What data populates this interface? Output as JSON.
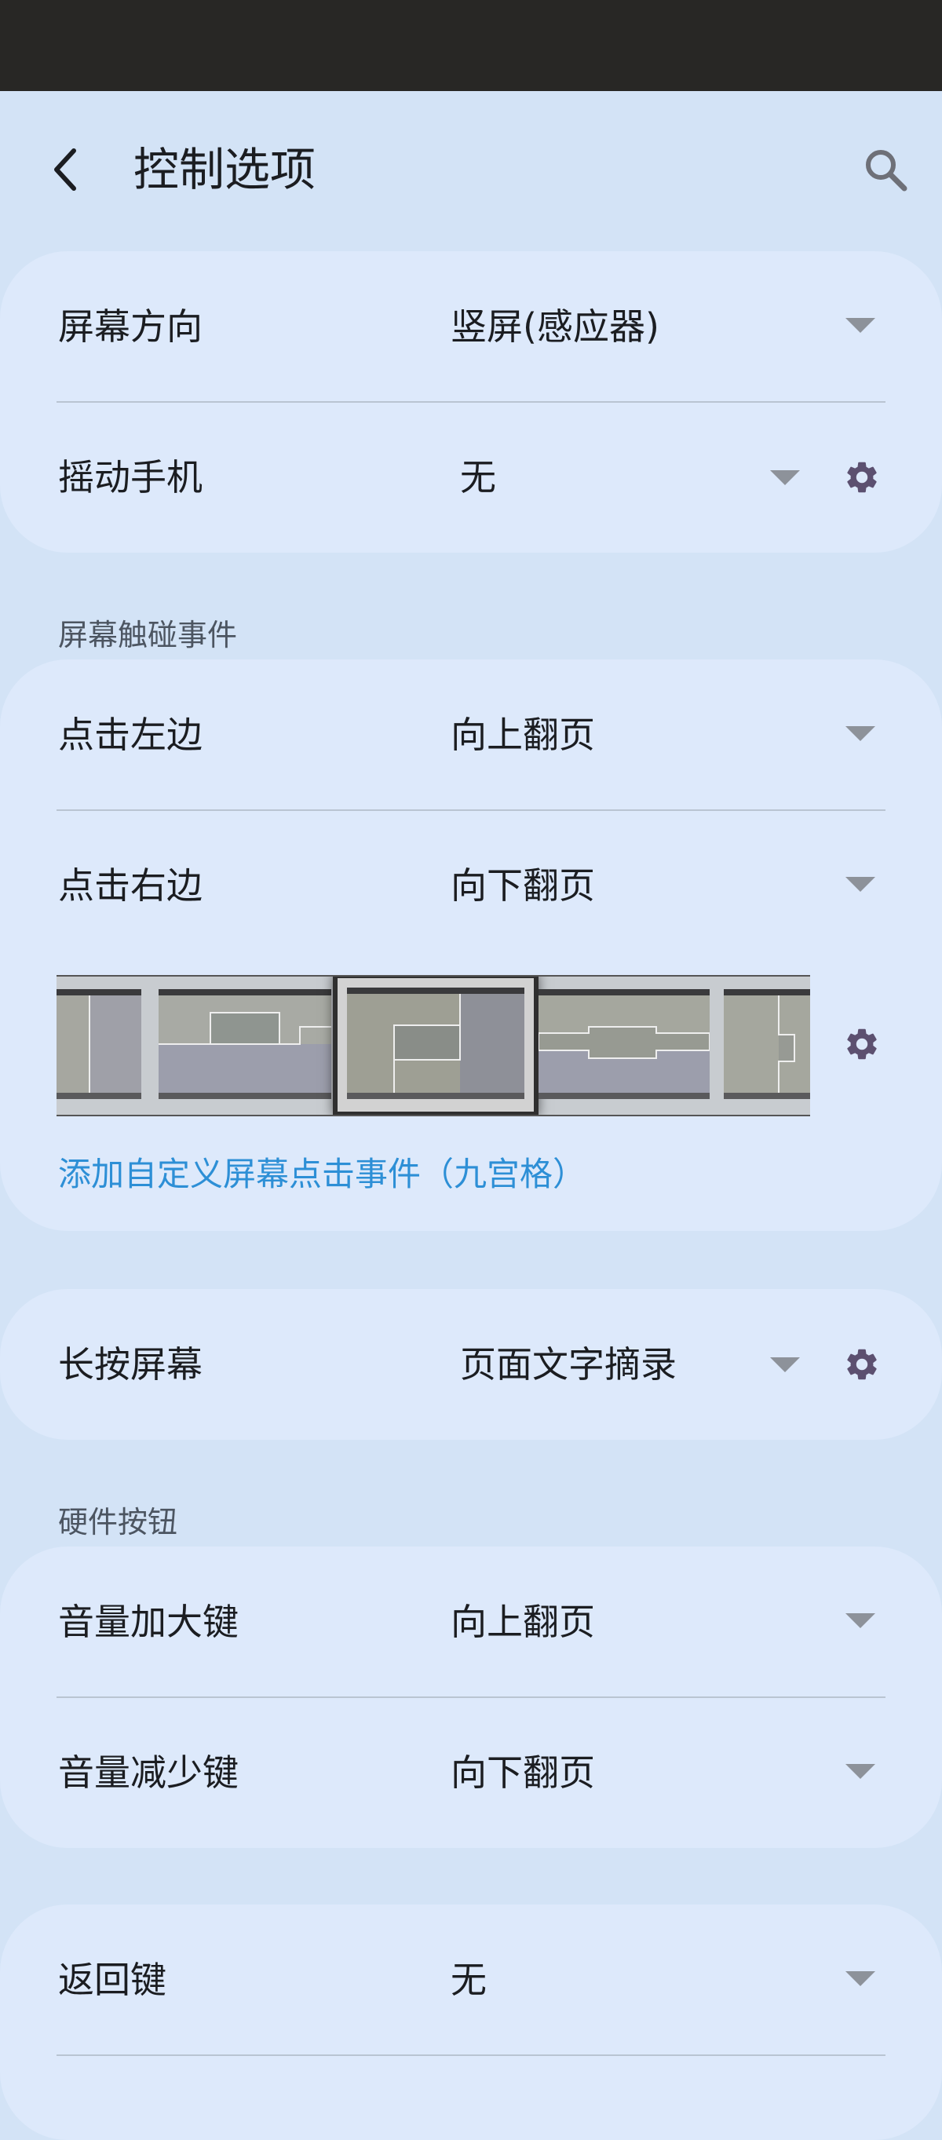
{
  "appbar": {
    "title": "控制选项",
    "back_icon": "chevron-left-icon",
    "search_icon": "search-icon"
  },
  "orientation_card": {
    "rows": [
      {
        "label": "屏幕方向",
        "value": "竖屏(感应器)"
      },
      {
        "label": "摇动手机",
        "value": "无"
      }
    ]
  },
  "touch_section": {
    "header": "屏幕触碰事件",
    "rows": [
      {
        "label": "点击左边",
        "value": "向上翻页"
      },
      {
        "label": "点击右边",
        "value": "向下翻页"
      }
    ],
    "layout_presets_count": 5,
    "selected_preset_index": 2,
    "add_custom_link": "添加自定义屏幕点击事件（九宫格）"
  },
  "long_press_card": {
    "label": "长按屏幕",
    "value": "页面文字摘录"
  },
  "hardware_section": {
    "header": "硬件按钮",
    "rows": [
      {
        "label": "音量加大键",
        "value": "向上翻页"
      },
      {
        "label": "音量减少键",
        "value": "向下翻页"
      }
    ]
  },
  "back_key_card": {
    "label": "返回键",
    "value": "无"
  },
  "colors": {
    "background": "#d3e3f6",
    "card": "#dde9fb",
    "link": "#2d8fd6",
    "gear": "#5c5070",
    "arrow": "#8d929a",
    "status_bar": "#282725"
  }
}
